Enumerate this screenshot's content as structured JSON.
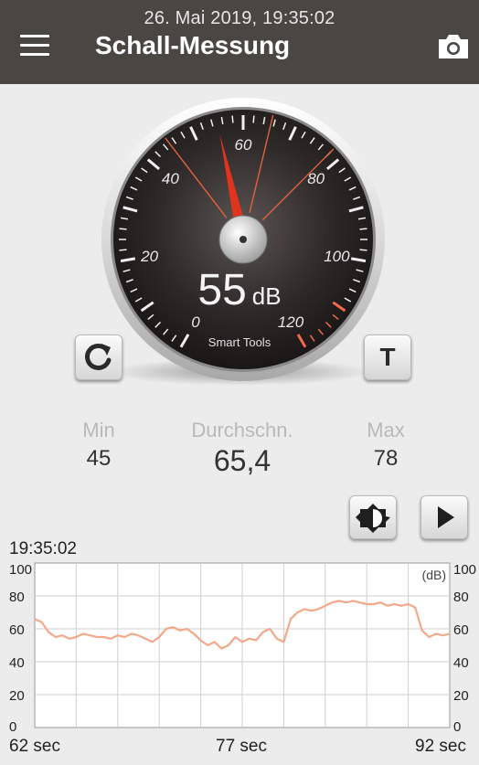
{
  "header": {
    "datetime": "26. Mai 2019, 19:35:02",
    "title": "Schall-Messung",
    "menu_icon": "hamburger-menu-icon",
    "camera_icon": "camera-icon"
  },
  "gauge": {
    "value": "55",
    "unit": "dB",
    "brand": "Smart Tools",
    "scale_labels": [
      "0",
      "20",
      "40",
      "60",
      "80",
      "100",
      "120"
    ],
    "needle_db": 55,
    "min_marker_db": 45,
    "avg_marker_db": 65.4,
    "max_marker_db": 78,
    "reset_icon": "refresh-icon",
    "t_button_label": "T"
  },
  "stats": {
    "min_label": "Min",
    "min_value": "45",
    "avg_label": "Durchschn.",
    "avg_value": "65,4",
    "max_label": "Max",
    "max_value": "78"
  },
  "controls": {
    "brightness_icon": "brightness-icon",
    "play_icon": "play-icon"
  },
  "chart_data": {
    "type": "line",
    "timestamp": "19:35:02",
    "unit_label": "(dB)",
    "y_ticks": [
      "100",
      "80",
      "60",
      "40",
      "20",
      "0"
    ],
    "x_labels": [
      "62 sec",
      "77 sec",
      "92 sec"
    ],
    "xlim": [
      62,
      92
    ],
    "ylim": [
      0,
      100
    ],
    "grid": true,
    "color": "#f2a98a",
    "x": [
      62,
      62.5,
      63,
      63.5,
      64,
      64.5,
      65,
      65.5,
      66,
      66.5,
      67,
      67.5,
      68,
      68.5,
      69,
      69.5,
      70,
      70.5,
      71,
      71.5,
      72,
      72.5,
      73,
      73.5,
      74,
      74.5,
      75,
      75.5,
      76,
      76.5,
      77,
      77.5,
      78,
      78.5,
      79,
      79.5,
      80,
      80.5,
      81,
      81.5,
      82,
      82.5,
      83,
      83.5,
      84,
      84.5,
      85,
      85.5,
      86,
      86.5,
      87,
      87.5,
      88,
      88.5,
      89,
      89.5,
      90,
      90.5,
      91,
      91.5,
      92
    ],
    "y": [
      66,
      64,
      58,
      55,
      56,
      54,
      55,
      57,
      56,
      55,
      55,
      54,
      56,
      55,
      57,
      56,
      54,
      52,
      55,
      60,
      61,
      59,
      60,
      57,
      53,
      50,
      52,
      48,
      50,
      55,
      52,
      54,
      53,
      58,
      60,
      54,
      52,
      66,
      70,
      72,
      71,
      72,
      74,
      76,
      77,
      76,
      77,
      76,
      75,
      75,
      76,
      74,
      75,
      74,
      75,
      73,
      59,
      55,
      57,
      56,
      57
    ]
  }
}
